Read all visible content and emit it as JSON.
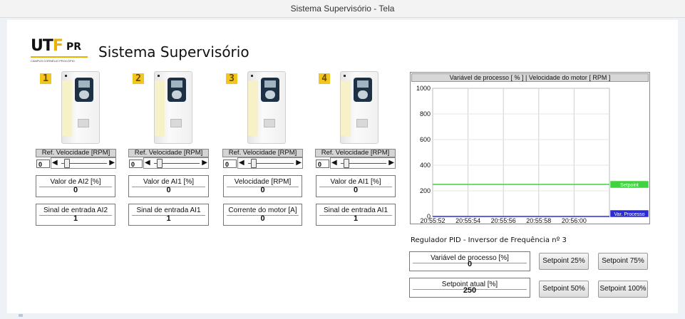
{
  "window": {
    "title": "Sistema Supervisório - Tela"
  },
  "header": {
    "logo_main": "UT",
    "logo_f": "F",
    "logo_pr": "PR",
    "logo_sub": "CAMPUS CORNÉLIO PROCÓPIO",
    "title": "Sistema Supervisório"
  },
  "drives": [
    {
      "number": "1",
      "speed_label": "Ref. Velocidade [RPM]",
      "speed_value": "0",
      "box1_label": "Valor de AI2 [%]",
      "box1_value": "0",
      "box2_label": "Sinal de entrada AI2",
      "box2_value": "1"
    },
    {
      "number": "2",
      "speed_label": "Ref. Velocidade [RPM]",
      "speed_value": "0",
      "box1_label": "Valor de AI1 [%]",
      "box1_value": "0",
      "box2_label": "Sinal de entrada AI1",
      "box2_value": "1"
    },
    {
      "number": "3",
      "speed_label": "Ref. Velocidade [RPM]",
      "speed_value": "0",
      "box1_label": "Velocidade [RPM]",
      "box1_value": "0",
      "box2_label": "Corrente do motor [A]",
      "box2_value": "0"
    },
    {
      "number": "4",
      "speed_label": "Ref. Velocidade [RPM]",
      "speed_value": "0",
      "box1_label": "Valor de AI1 [%]",
      "box1_value": "0",
      "box2_label": "Sinal de entrada AI1",
      "box2_value": "1"
    }
  ],
  "slider_arrows": {
    "left": "◀",
    "right": "▶"
  },
  "chart_data": {
    "type": "line",
    "title": "Variável de processo [ % ] | Velocidade do motor [ RPM ]",
    "ylim": [
      0,
      1000
    ],
    "yticks": [
      "1000",
      "800",
      "600",
      "400",
      "200",
      "0"
    ],
    "xticks": [
      "20:55:52",
      "20:55:54",
      "20:55:56",
      "20:55:58",
      "20:56:00"
    ],
    "series": [
      {
        "name": "Setpoint",
        "color": "#3fd43f",
        "values": [
          250,
          250,
          250,
          250,
          250
        ]
      },
      {
        "name": "Var. Processo",
        "color": "#2b2bd6",
        "values": [
          0,
          0,
          0,
          0,
          0
        ]
      }
    ],
    "grid": true
  },
  "pid": {
    "title": "Regulador PID - Inversor de Frequência nº 3",
    "process_label": "Variável de processo [%]",
    "process_value": "0",
    "setpoint_label": "Setpoint atual [%]",
    "setpoint_value": "250",
    "buttons": {
      "sp25": "Setpoint 25%",
      "sp75": "Setpoint 75%",
      "sp50": "Setpoint 50%",
      "sp100": "Setpoint 100%"
    }
  }
}
